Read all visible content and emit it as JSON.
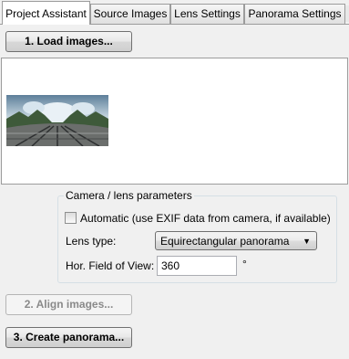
{
  "tabs": [
    {
      "label": "Project Assistant",
      "active": true
    },
    {
      "label": "Source Images",
      "active": false
    },
    {
      "label": "Lens Settings",
      "active": false
    },
    {
      "label": "Panorama Settings",
      "active": false
    }
  ],
  "tab_scroll_icon": "tab-scroll-arrows",
  "buttons": {
    "load": "1. Load images...",
    "align": "2. Align images...",
    "create": "3. Create panorama..."
  },
  "camera_group": {
    "title": "Camera / lens parameters",
    "automatic_label": "Automatic (use EXIF data from camera, if available)",
    "automatic_checked": false,
    "lens_type_label": "Lens type:",
    "lens_type_value": "Equirectangular panorama",
    "hfov_label": "Hor. Field of View:",
    "hfov_value": "360",
    "hfov_unit": "°"
  },
  "colors": {
    "window_bg": "#f0f0f0",
    "border": "#9c9c9c",
    "disabled_text": "#8a8a8a"
  }
}
